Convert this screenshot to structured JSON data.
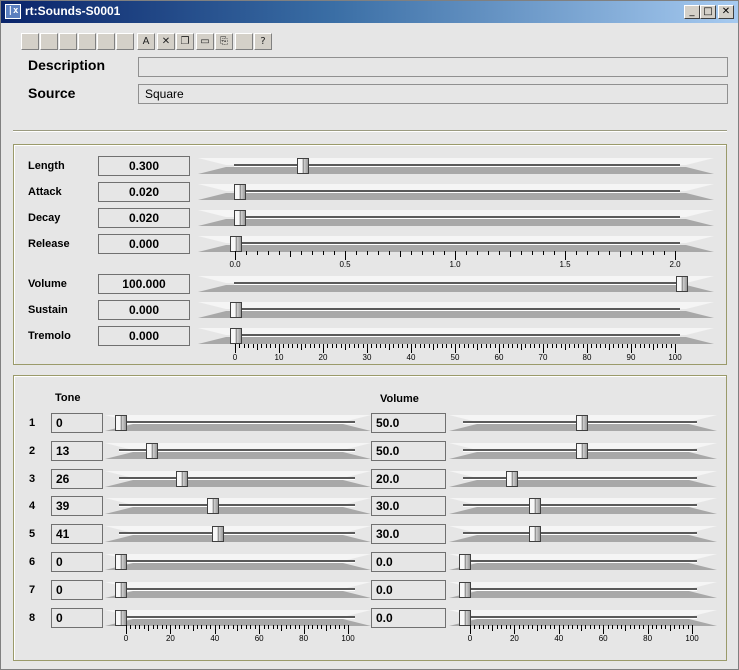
{
  "window": {
    "title": "rt:Sounds-S0001",
    "icon": "x-app-icon",
    "controls": [
      "minimize",
      "maximize",
      "close"
    ]
  },
  "toolbar": {
    "buttons": [
      {
        "name": "tool-1",
        "glyph": "",
        "enabled": false
      },
      {
        "name": "tool-2",
        "glyph": "",
        "enabled": false
      },
      {
        "name": "tool-3",
        "glyph": "",
        "enabled": false
      },
      {
        "name": "tool-4",
        "glyph": "",
        "enabled": false
      },
      {
        "name": "tool-5",
        "glyph": "",
        "enabled": false
      },
      {
        "name": "tool-6",
        "glyph": "",
        "enabled": false
      },
      {
        "name": "edit-tool",
        "glyph": "A",
        "enabled": true
      },
      {
        "name": "cut-tool",
        "glyph": "✕",
        "enabled": true
      },
      {
        "name": "copy-tool",
        "glyph": "❐",
        "enabled": true
      },
      {
        "name": "paste-tool",
        "glyph": "▭",
        "enabled": true
      },
      {
        "name": "clipboard-tool",
        "glyph": "⎘",
        "enabled": true
      },
      {
        "name": "tool-12",
        "glyph": "",
        "enabled": false
      },
      {
        "name": "help-tool",
        "glyph": "?",
        "enabled": true
      }
    ]
  },
  "description": {
    "label": "Description",
    "value": ""
  },
  "source": {
    "label": "Source",
    "value": "Square"
  },
  "envelope": {
    "rows": [
      {
        "key": "length",
        "label": "Length",
        "value": "0.300",
        "fraction": 0.15
      },
      {
        "key": "attack",
        "label": "Attack",
        "value": "0.020",
        "fraction": 0.01
      },
      {
        "key": "decay",
        "label": "Decay",
        "value": "0.020",
        "fraction": 0.01
      },
      {
        "key": "release",
        "label": "Release",
        "value": "0.000",
        "fraction": 0.0
      }
    ],
    "scale": {
      "min": 0,
      "max": 2,
      "major": [
        "0.0",
        "0.5",
        "1.0",
        "1.5",
        "2.0"
      ]
    }
  },
  "levels": {
    "rows": [
      {
        "key": "volume",
        "label": "Volume",
        "value": "100.000",
        "fraction": 1.0
      },
      {
        "key": "sustain",
        "label": "Sustain",
        "value": "0.000",
        "fraction": 0.0
      },
      {
        "key": "tremolo",
        "label": "Tremolo",
        "value": "0.000",
        "fraction": 0.0
      }
    ],
    "scale": {
      "min": 0,
      "max": 100,
      "major": [
        "0",
        "10",
        "20",
        "30",
        "40",
        "50",
        "60",
        "70",
        "80",
        "90",
        "100"
      ]
    }
  },
  "tones": {
    "tone_header": "Tone",
    "volume_header": "Volume",
    "rows": [
      {
        "index": "1",
        "tone": "0",
        "tone_fraction": 0.0,
        "volume": "50.0",
        "volume_fraction": 0.5
      },
      {
        "index": "2",
        "tone": "13",
        "tone_fraction": 0.13,
        "volume": "50.0",
        "volume_fraction": 0.5
      },
      {
        "index": "3",
        "tone": "26",
        "tone_fraction": 0.26,
        "volume": "20.0",
        "volume_fraction": 0.2
      },
      {
        "index": "4",
        "tone": "39",
        "tone_fraction": 0.39,
        "volume": "30.0",
        "volume_fraction": 0.3
      },
      {
        "index": "5",
        "tone": "41",
        "tone_fraction": 0.41,
        "volume": "30.0",
        "volume_fraction": 0.3
      },
      {
        "index": "6",
        "tone": "0",
        "tone_fraction": 0.0,
        "volume": "0.0",
        "volume_fraction": 0.0
      },
      {
        "index": "7",
        "tone": "0",
        "tone_fraction": 0.0,
        "volume": "0.0",
        "volume_fraction": 0.0
      },
      {
        "index": "8",
        "tone": "0",
        "tone_fraction": 0.0,
        "volume": "0.0",
        "volume_fraction": 0.0
      }
    ],
    "tone_scale": {
      "min": 0,
      "max": 100,
      "major": [
        "0",
        "20",
        "40",
        "60",
        "80",
        "100"
      ]
    },
    "volume_scale": {
      "min": 0,
      "max": 100,
      "major": [
        "0",
        "20",
        "40",
        "60",
        "80",
        "100"
      ]
    }
  }
}
